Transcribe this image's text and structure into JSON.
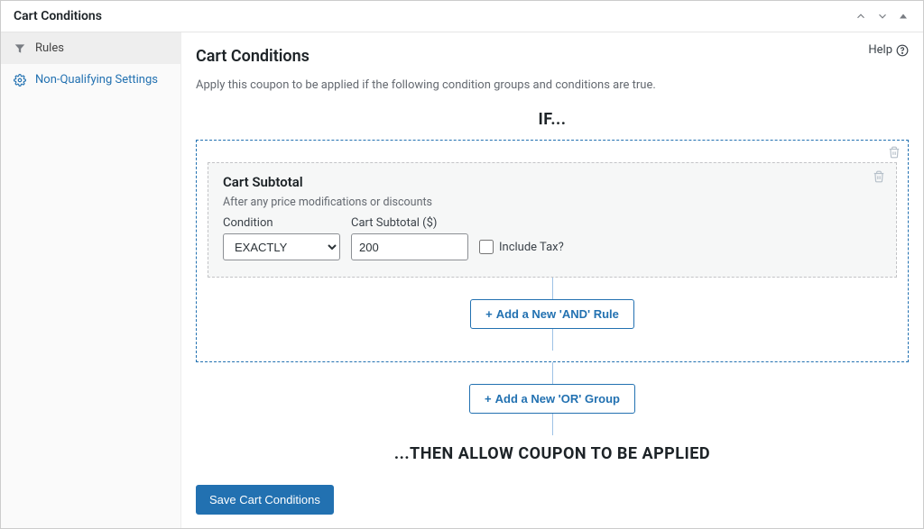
{
  "header": {
    "title": "Cart Conditions"
  },
  "sidebar": {
    "items": [
      {
        "label": "Rules"
      },
      {
        "label": "Non-Qualifying Settings"
      }
    ]
  },
  "main": {
    "help": "Help",
    "title": "Cart Conditions",
    "description": "Apply this coupon to be applied if the following condition groups and conditions are true.",
    "if_label": "IF...",
    "then_label": "...THEN ALLOW COUPON TO BE APPLIED",
    "add_and_label": "Add a New 'AND' Rule",
    "add_or_label": "Add a New 'OR' Group",
    "save_label": "Save Cart Conditions"
  },
  "rule": {
    "title": "Cart Subtotal",
    "subtitle": "After any price modifications or discounts",
    "condition_label": "Condition",
    "condition_value": "EXACTLY",
    "amount_label": "Cart Subtotal ($)",
    "amount_value": "200",
    "include_tax_label": "Include Tax?"
  }
}
